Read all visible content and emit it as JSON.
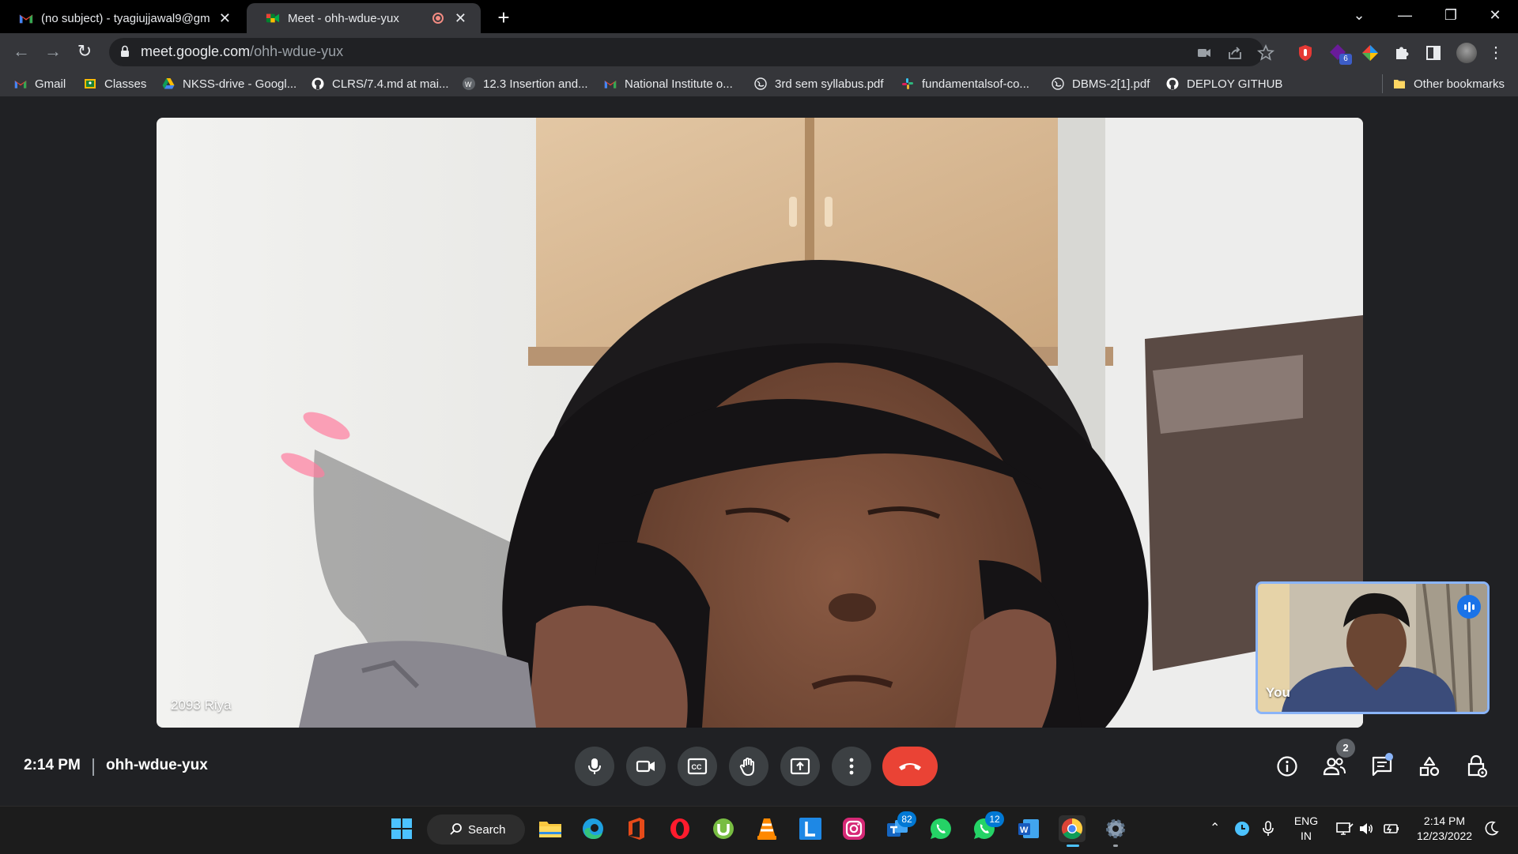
{
  "browser": {
    "tabs": [
      {
        "title": "(no subject) - tyagiujjawal9@gm",
        "close": "✕"
      },
      {
        "title": "Meet - ohh-wdue-yux",
        "close": "✕"
      }
    ],
    "new_tab": "+",
    "url_host": "meet.google.com",
    "url_path": "/ohh-wdue-yux",
    "extension_badge": "6",
    "bookmarks": [
      {
        "label": "Gmail",
        "icon": "gmail-icon"
      },
      {
        "label": "Classes",
        "icon": "classroom-icon"
      },
      {
        "label": "NKSS-drive - Googl...",
        "icon": "drive-icon"
      },
      {
        "label": "CLRS/7.4.md at mai...",
        "icon": "github-icon"
      },
      {
        "label": "12.3 Insertion and...",
        "icon": "walkccc-icon"
      },
      {
        "label": "National Institute o...",
        "icon": "gmail-icon"
      },
      {
        "label": "3rd sem syllabus.pdf",
        "icon": "globe-icon"
      },
      {
        "label": "fundamentalsof-co...",
        "icon": "slack-icon"
      },
      {
        "label": "DBMS-2[1].pdf",
        "icon": "globe-icon"
      },
      {
        "label": "DEPLOY GITHUB",
        "icon": "github-icon"
      }
    ],
    "other_bookmarks": "Other bookmarks"
  },
  "meet": {
    "main_participant": "2093 Riya",
    "self_label": "You",
    "time": "2:14 PM",
    "meeting_code": "ohh-wdue-yux",
    "participants_count": "2",
    "colors": {
      "hangup": "#ea4335",
      "control_bg": "#3c4043",
      "accent": "#8ab4f8"
    }
  },
  "taskbar": {
    "search_label": "Search",
    "teams_badge": "82",
    "whatsapp_badge": "12",
    "language_line1": "ENG",
    "language_line2": "IN",
    "clock_time": "2:14 PM",
    "clock_date": "12/23/2022"
  }
}
